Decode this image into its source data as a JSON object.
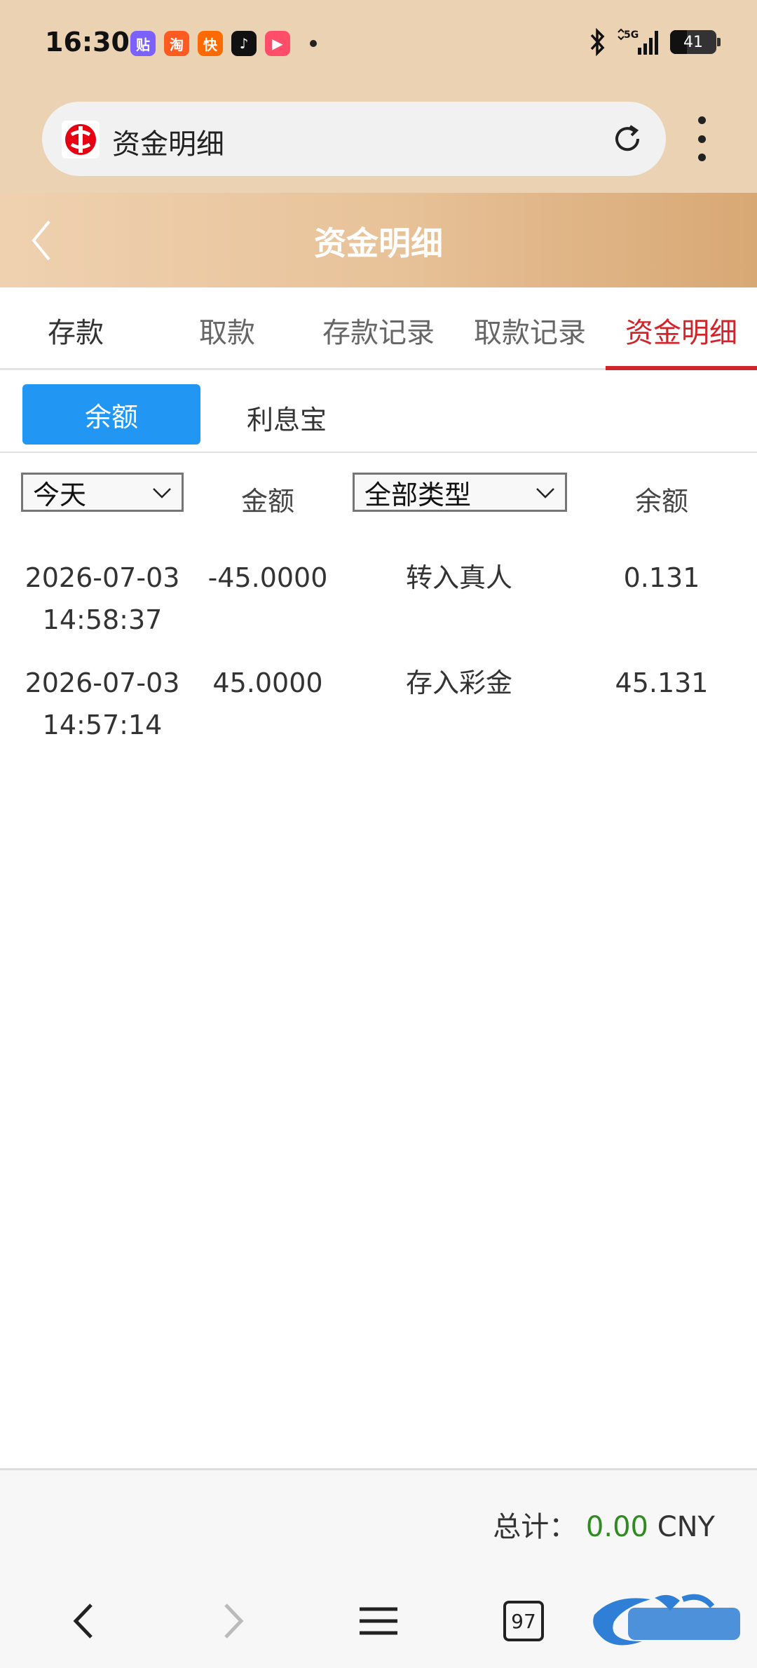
{
  "status_bar": {
    "time": "16:30",
    "app_icons": [
      {
        "name": "tieba-icon",
        "glyph": "贴",
        "color": "#7b61ff"
      },
      {
        "name": "taobao-icon",
        "glyph": "淘",
        "color": "#ff5a1f"
      },
      {
        "name": "kuaishou-icon",
        "glyph": "快",
        "color": "#ff6a00"
      },
      {
        "name": "tiktok-icon",
        "glyph": "♪",
        "color": "#111111"
      },
      {
        "name": "video-player-icon",
        "glyph": "▶",
        "color": "#ff4d6a"
      }
    ],
    "network": "5G",
    "battery": "41"
  },
  "browser": {
    "url_title": "资金明细",
    "tab_count": "97"
  },
  "header": {
    "title": "资金明细"
  },
  "tabs": [
    {
      "label": "存款"
    },
    {
      "label": "取款"
    },
    {
      "label": "存款记录"
    },
    {
      "label": "取款记录"
    },
    {
      "label": "资金明细"
    }
  ],
  "subtabs": {
    "active": "余额",
    "other": "利息宝"
  },
  "filters": {
    "date_selected": "今天",
    "type_selected": "全部类型",
    "amount_header": "金额",
    "balance_header": "余额"
  },
  "rows": [
    {
      "date": "2026-07-03",
      "time": "14:58:37",
      "amount": "-45.0000",
      "type": "转入真人",
      "balance": "0.131"
    },
    {
      "date": "2026-07-03",
      "time": "14:57:14",
      "amount": "45.0000",
      "type": "存入彩金",
      "balance": "45.131"
    }
  ],
  "footer": {
    "total_label": "总计：",
    "total_amount": "0.00",
    "currency": "CNY"
  },
  "colors": {
    "accent_red": "#d1242b",
    "accent_blue": "#2196f3",
    "total_green": "#2e8b20"
  }
}
